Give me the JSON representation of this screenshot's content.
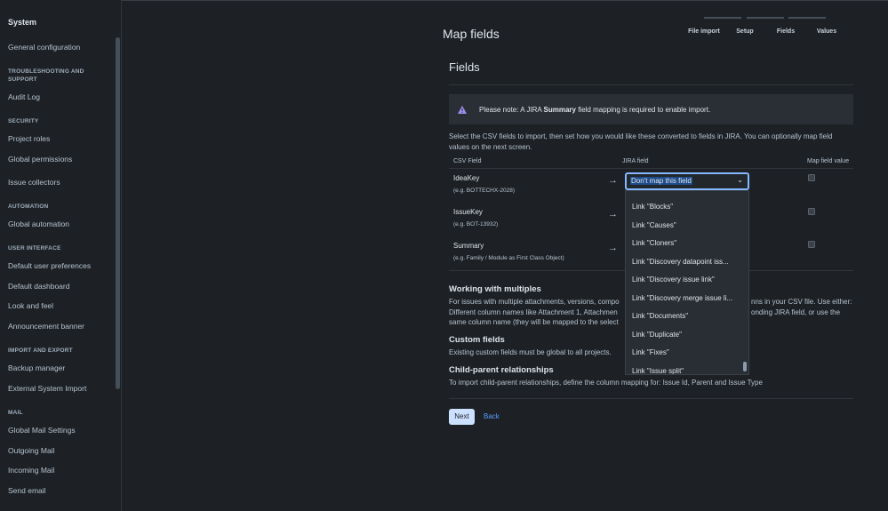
{
  "sidebar": {
    "title": "System",
    "items": [
      {
        "type": "item",
        "label": "General configuration"
      },
      {
        "type": "heading",
        "label": "TROUBLESHOOTING AND SUPPORT"
      },
      {
        "type": "item",
        "label": "Audit Log"
      },
      {
        "type": "heading",
        "label": "SECURITY"
      },
      {
        "type": "item",
        "label": "Project roles"
      },
      {
        "type": "item",
        "label": "Global permissions"
      },
      {
        "type": "item",
        "label": "Issue collectors"
      },
      {
        "type": "heading",
        "label": "AUTOMATION"
      },
      {
        "type": "item",
        "label": "Global automation"
      },
      {
        "type": "heading",
        "label": "USER INTERFACE"
      },
      {
        "type": "item",
        "label": "Default user preferences"
      },
      {
        "type": "item",
        "label": "Default dashboard"
      },
      {
        "type": "item",
        "label": "Look and feel"
      },
      {
        "type": "item",
        "label": "Announcement banner"
      },
      {
        "type": "heading",
        "label": "IMPORT AND EXPORT"
      },
      {
        "type": "item",
        "label": "Backup manager"
      },
      {
        "type": "item",
        "label": "External System Import"
      },
      {
        "type": "heading",
        "label": "MAIL"
      },
      {
        "type": "item",
        "label": "Global Mail Settings"
      },
      {
        "type": "item",
        "label": "Outgoing Mail"
      },
      {
        "type": "item",
        "label": "Incoming Mail"
      },
      {
        "type": "item",
        "label": "Send email"
      }
    ]
  },
  "header": {
    "page_title": "Map fields",
    "steps": [
      "File import",
      "Setup",
      "Fields",
      "Values"
    ]
  },
  "fields": {
    "title": "Fields",
    "note_prefix": "Please note: A JIRA ",
    "note_bold": "Summary",
    "note_suffix": " field mapping is required to enable import.",
    "intro": "Select the CSV fields to import, then set how you would like these converted to fields in JIRA. You can optionally map field values on the next screen.",
    "columns": {
      "csv": "CSV Field",
      "jira": "JIRA field",
      "map": "Map field value"
    },
    "rows": [
      {
        "name": "IdeaKey",
        "example": "(e.g. BOTTECHX-2028)"
      },
      {
        "name": "IssueKey",
        "example": "(e.g. BOT-13932)"
      },
      {
        "name": "Summary",
        "example": "(e.g. Family / Module as First Class Object)"
      }
    ],
    "arrow_glyph": "→",
    "select_value": "Don't map this field",
    "chevron_glyph": "⌄",
    "dropdown_options": [
      "Link \"Blocks\"",
      "Link \"Causes\"",
      "Link \"Cloners\"",
      "Link \"Discovery datapoint iss...",
      "Link \"Discovery issue link\"",
      "Link \"Discovery merge issue li...",
      "Link \"Documents\"",
      "Link \"Duplicate\"",
      "Link \"Fixes\"",
      "Link \"Issue split\""
    ]
  },
  "multiples": {
    "title": "Working with multiples",
    "line1_a": "For issues with multiple attachments, versions, compo",
    "line1_b": "nns in your CSV file. Use either:",
    "line2_a": "Different column names like Attachment 1, Attachmen",
    "line2_b": "onding JIRA field, or use the",
    "line3_a": "same column name (they will be mapped to the select"
  },
  "custom_fields": {
    "title": "Custom fields",
    "text": "Existing custom fields must be global to all projects."
  },
  "child_parent": {
    "title": "Child-parent relationships",
    "text": "To import child-parent relationships, define the column mapping for: Issue Id, Parent and Issue Type"
  },
  "buttons": {
    "next": "Next",
    "back": "Back"
  },
  "colors": {
    "background": "#1d2125",
    "primary_button": "#cce0ff",
    "link": "#579dff",
    "focus": "#85b8ff",
    "warning_icon": "#9f8fef"
  }
}
